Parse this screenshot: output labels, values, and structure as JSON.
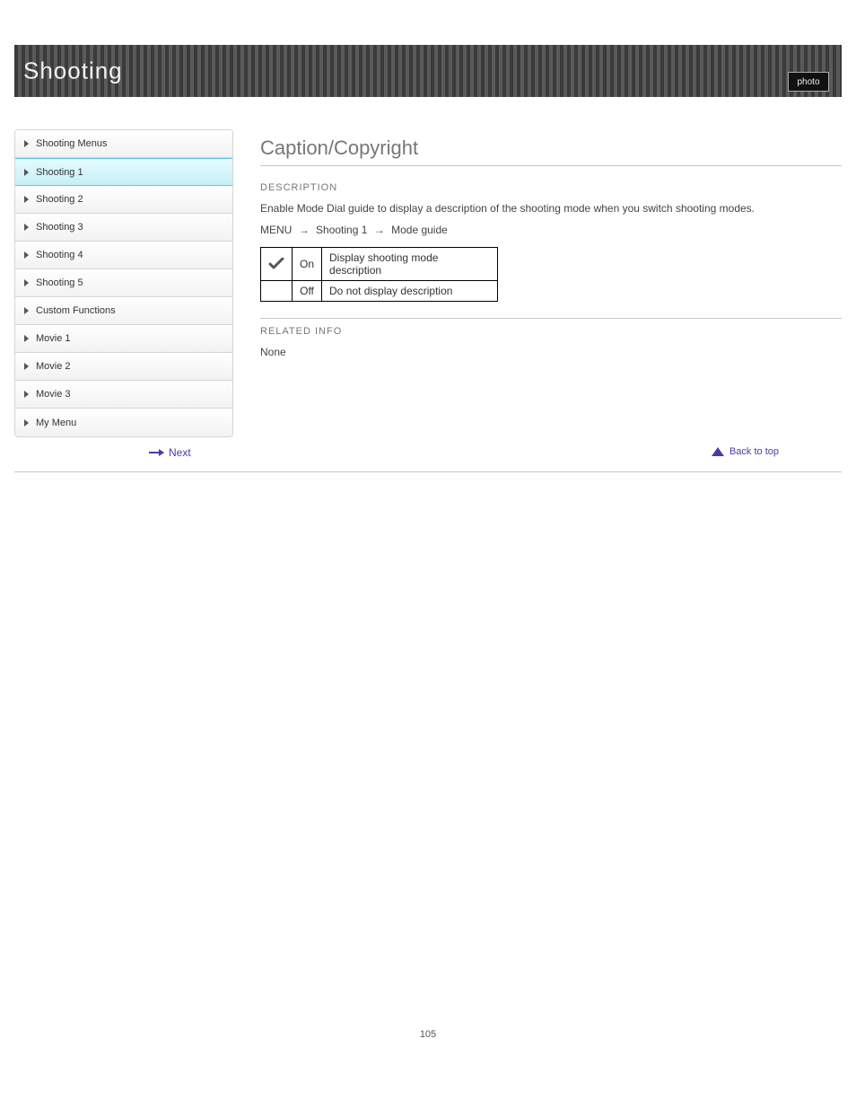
{
  "page_number": "105",
  "header": {
    "title": "Shooting",
    "tab_label": "photo"
  },
  "sidebar": {
    "items": [
      {
        "label": "Shooting Menus"
      },
      {
        "label": "Shooting 1"
      },
      {
        "label": "Shooting 2"
      },
      {
        "label": "Shooting 3"
      },
      {
        "label": "Shooting 4"
      },
      {
        "label": "Shooting 5"
      },
      {
        "label": "Custom Functions"
      },
      {
        "label": "Movie 1"
      },
      {
        "label": "Movie 2"
      },
      {
        "label": "Movie 3"
      },
      {
        "label": "My Menu"
      }
    ],
    "active_index": 1
  },
  "main": {
    "title": "Caption/Copyright",
    "section_label": "DESCRIPTION",
    "body_text": "Enable Mode Dial guide to display a description of the shooting mode when you switch shooting modes.",
    "path": {
      "seg1": "MENU",
      "seg2": "Shooting 1",
      "seg3": "Mode guide"
    },
    "table": {
      "rows": [
        {
          "checked": true,
          "value": "On",
          "desc": "Display shooting mode description"
        },
        {
          "checked": false,
          "value": "Off",
          "desc": "Do not display description"
        }
      ]
    },
    "related_label": "RELATED INFO",
    "related_text": "None"
  },
  "nav": {
    "next_label": "Next",
    "back_to_top": "Back to top"
  }
}
